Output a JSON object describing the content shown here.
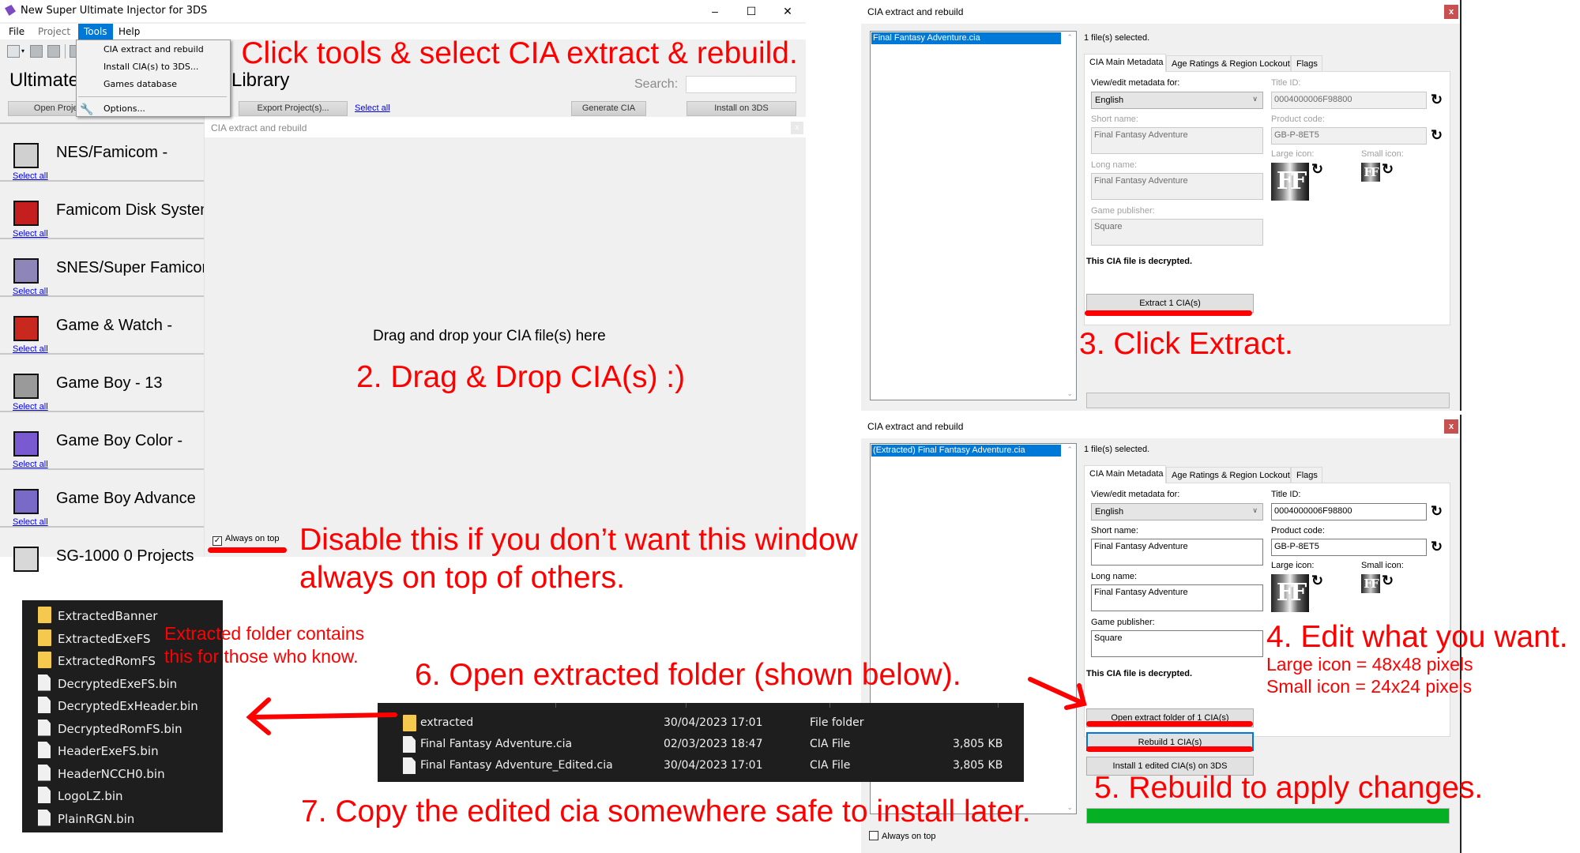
{
  "main_window": {
    "title": "New Super Ultimate Injector for 3DS",
    "window_controls": {
      "minimize": "–",
      "maximize": "☐",
      "close": "✕"
    },
    "menu": [
      {
        "label": "File",
        "state": "normal"
      },
      {
        "label": "Project",
        "state": "disabled"
      },
      {
        "label": "Tools",
        "state": "active"
      },
      {
        "label": "Help",
        "state": "normal"
      }
    ],
    "heading_left": "Ultimate",
    "heading_right": "Library",
    "search_label": "Search:",
    "search_value": "",
    "buttons": {
      "open_project": "Open Project",
      "export_projects": "Export Project(s)...",
      "select_all": "Select all",
      "generate_cia": "Generate CIA",
      "install_on_3ds": "Install on 3DS"
    },
    "systems": [
      {
        "name": "NES/Famicom   -",
        "select_all": "Select all",
        "icon": "nes-console-icon",
        "color": "#d0d0d0"
      },
      {
        "name": "Famicom Disk System",
        "select_all": "Select all",
        "icon": "famicom-disk-icon",
        "color": "#c41e1e"
      },
      {
        "name": "SNES/Super Famicom",
        "select_all": "Select all",
        "icon": "snes-console-icon",
        "color": "#8e86b8"
      },
      {
        "name": "Game & Watch   -",
        "select_all": "Select all",
        "icon": "game-and-watch-icon",
        "color": "#c8281e"
      },
      {
        "name": "Game Boy   -   13",
        "select_all": "Select all",
        "icon": "game-boy-icon",
        "color": "#9a9a9a"
      },
      {
        "name": "Game Boy Color   -",
        "select_all": "Select all",
        "icon": "game-boy-color-icon",
        "color": "#7a5ad0"
      },
      {
        "name": "Game Boy Advance",
        "select_all": "Select all",
        "icon": "game-boy-advance-icon",
        "color": "#7a6ac8"
      },
      {
        "name": "SG-1000        0 Projects",
        "select_all": "",
        "icon": "sg-1000-icon",
        "color": "#d8d8d8"
      }
    ]
  },
  "tools_menu": {
    "items": [
      {
        "label": "CIA extract and rebuild"
      },
      {
        "label": "Install CIA(s) to 3DS..."
      },
      {
        "label": "Games database"
      },
      {
        "label": "Options...",
        "icon": "wrench-icon"
      }
    ]
  },
  "drop_dialog": {
    "title": "CIA extract and rebuild",
    "close": "x",
    "drop_label": "Drag and drop your CIA file(s) here",
    "always_on_top": {
      "label": "Always on top",
      "checked": true
    }
  },
  "extract_dialog": {
    "title": "CIA extract and rebuild",
    "close": "x",
    "file_item": "Final Fantasy Adventure.cia",
    "selection_count": "1 file(s) selected.",
    "tabs": [
      "CIA Main Metadata",
      "Age Ratings & Region Lockout",
      "Flags"
    ],
    "view_edit_label": "View/edit metadata for:",
    "language": "English",
    "short_name_label": "Short name:",
    "short_name": "Final Fantasy Adventure",
    "long_name_label": "Long name:",
    "long_name": "Final Fantasy Adventure",
    "publisher_label": "Game publisher:",
    "publisher": "Square",
    "title_id_label": "Title ID:",
    "title_id": "0004000006F98800",
    "product_code_label": "Product code:",
    "product_code": "GB-P-8ET5",
    "large_icon_label": "Large icon:",
    "small_icon_label": "Small icon:",
    "icon_text": "FF",
    "status": "This CIA file is decrypted.",
    "extract_button": "Extract 1 CIA(s)",
    "progress_percent": 0
  },
  "rebuild_dialog": {
    "title": "CIA extract and rebuild",
    "close": "x",
    "file_item": "(Extracted) Final Fantasy Adventure.cia",
    "selection_count": "1 file(s) selected.",
    "tabs": [
      "CIA Main Metadata",
      "Age Ratings & Region Lockout",
      "Flags"
    ],
    "view_edit_label": "View/edit metadata for:",
    "language": "English",
    "short_name_label": "Short name:",
    "short_name": "Final Fantasy Adventure",
    "long_name_label": "Long name:",
    "long_name": "Final Fantasy Adventure",
    "publisher_label": "Game publisher:",
    "publisher": "Square",
    "title_id_label": "Title ID:",
    "title_id": "0004000006F98800",
    "product_code_label": "Product code:",
    "product_code": "GB-P-8ET5",
    "large_icon_label": "Large icon:",
    "small_icon_label": "Small icon:",
    "icon_text": "FF",
    "status": "This CIA file is decrypted.",
    "open_folder_button": "Open extract folder of 1 CIA(s)",
    "rebuild_button": "Rebuild 1 CIA(s)",
    "install_button": "Install 1 edited CIA(s) on 3DS",
    "progress_percent": 100,
    "always_on_top": {
      "label": "Always on top",
      "checked": false
    }
  },
  "extracted_contents": [
    {
      "name": "ExtractedBanner",
      "type": "folder"
    },
    {
      "name": "ExtractedExeFS",
      "type": "folder"
    },
    {
      "name": "ExtractedRomFS",
      "type": "folder"
    },
    {
      "name": "DecryptedExeFS.bin",
      "type": "file"
    },
    {
      "name": "DecryptedExHeader.bin",
      "type": "file"
    },
    {
      "name": "DecryptedRomFS.bin",
      "type": "file"
    },
    {
      "name": "HeaderExeFS.bin",
      "type": "file"
    },
    {
      "name": "HeaderNCCH0.bin",
      "type": "file"
    },
    {
      "name": "LogoLZ.bin",
      "type": "file"
    },
    {
      "name": "PlainRGN.bin",
      "type": "file"
    }
  ],
  "explorer_rows": [
    {
      "name": "extracted",
      "date": "30/04/2023 17:01",
      "type": "File folder",
      "size": "",
      "kind": "folder"
    },
    {
      "name": "Final Fantasy Adventure.cia",
      "date": "02/03/2023 18:47",
      "type": "CIA File",
      "size": "3,805 KB",
      "kind": "file"
    },
    {
      "name": "Final Fantasy Adventure_Edited.cia",
      "date": "30/04/2023 17:01",
      "type": "CIA File",
      "size": "3,805 KB",
      "kind": "file"
    }
  ],
  "annotations": {
    "step1": "1. Click tools & select CIA extract & rebuild.",
    "step2": "2. Drag & Drop CIA(s) :)",
    "aot_line1": "Disable this if you don’t want this window",
    "aot_line2": "always on top of others.",
    "step3": "3. Click Extract.",
    "step4": "4. Edit what you want.",
    "large_icon_note": "Large icon = 48x48 pixels",
    "small_icon_note": "Small icon = 24x24 pixels",
    "step5": "5. Rebuild to apply changes.",
    "step6": "6. Open extracted folder (shown below).",
    "step7": "7. Copy the edited cia somewhere safe to install later.",
    "extracted_note_1": "Extracted folder contains",
    "extracted_note_2": "this for those who know.",
    "color": "#ff0000"
  }
}
